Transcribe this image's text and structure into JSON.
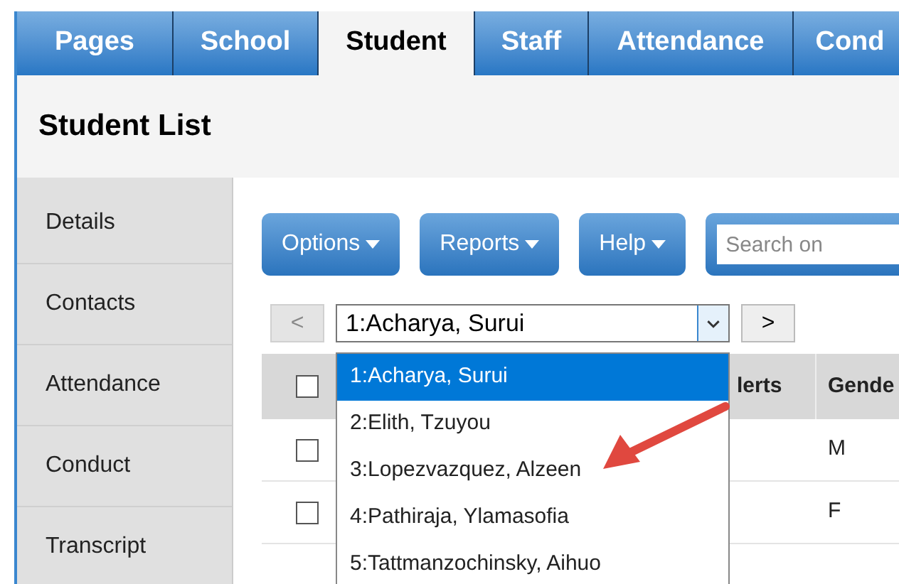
{
  "tabs": [
    {
      "label": "Pages",
      "selected": false
    },
    {
      "label": "School",
      "selected": false
    },
    {
      "label": "Student",
      "selected": true
    },
    {
      "label": "Staff",
      "selected": false
    },
    {
      "label": "Attendance",
      "selected": false
    },
    {
      "label": "Cond",
      "selected": false
    }
  ],
  "page_title": "Student List",
  "sidebar": {
    "items": [
      "Details",
      "Contacts",
      "Attendance",
      "Conduct",
      "Transcript"
    ]
  },
  "toolbar": {
    "buttons": [
      "Options",
      "Reports",
      "Help"
    ],
    "search": {
      "placeholder": "Search on"
    }
  },
  "navigator": {
    "prev": "<",
    "next": ">",
    "value": "1:Acharya, Surui",
    "options": [
      {
        "label": "1:Acharya, Surui",
        "selected": true
      },
      {
        "label": "2:Elith, Tzuyou",
        "selected": false
      },
      {
        "label": "3:Lopezvazquez, Alzeen",
        "selected": false
      },
      {
        "label": "4:Pathiraja, Ylamasofia",
        "selected": false
      },
      {
        "label": "5:Tattmanzochinsky, Aihuo",
        "selected": false
      }
    ]
  },
  "table": {
    "columns": [
      "lerts",
      "Gende"
    ],
    "header_checked": false,
    "rows": [
      {
        "checked": false,
        "column_3": "M"
      },
      {
        "checked": false,
        "column_3": "F"
      }
    ]
  }
}
